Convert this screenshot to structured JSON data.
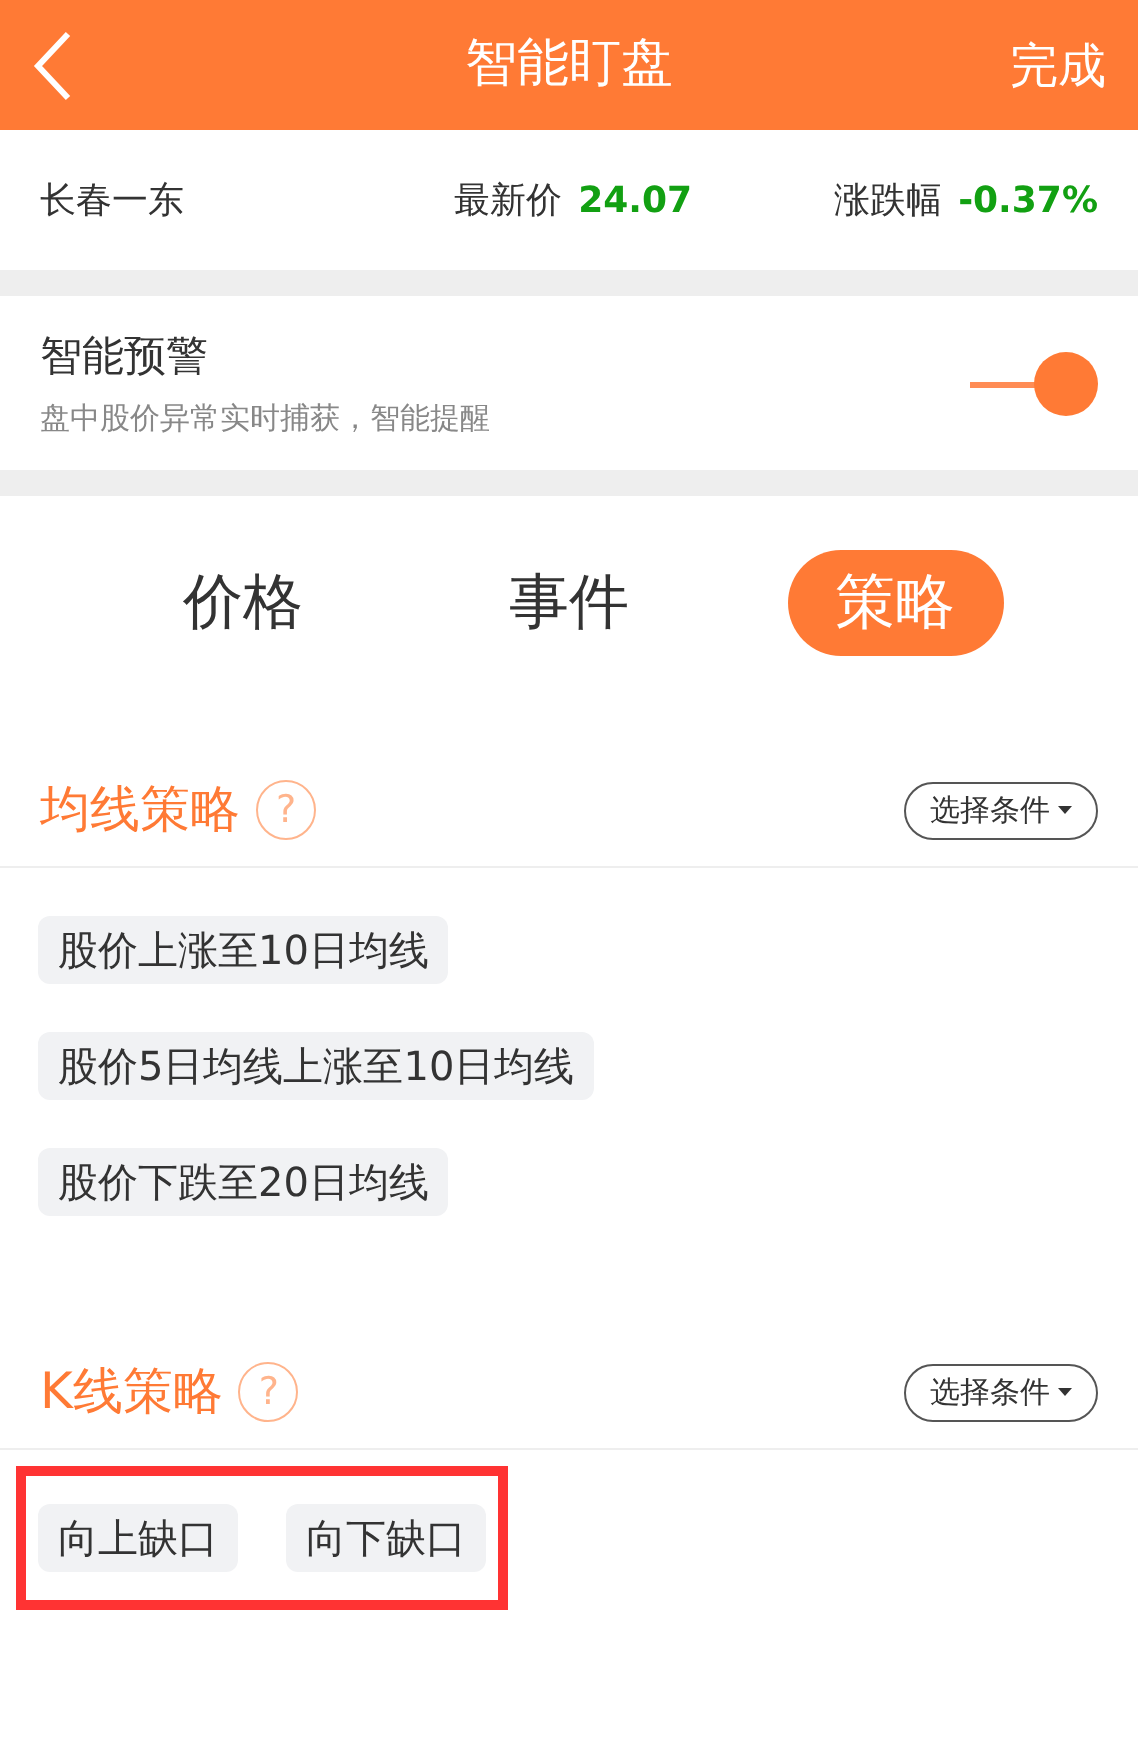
{
  "header": {
    "title": "智能盯盘",
    "action": "完成"
  },
  "quote": {
    "name": "长春一东",
    "price_label": "最新价",
    "price": "24.07",
    "change_label": "涨跌幅",
    "change": "-0.37%"
  },
  "alert": {
    "title": "智能预警",
    "subtitle": "盘中股价异常实时捕获，智能提醒",
    "on": true
  },
  "tabs": [
    {
      "label": "价格",
      "selected": false
    },
    {
      "label": "事件",
      "selected": false
    },
    {
      "label": "策略",
      "selected": true
    }
  ],
  "sections": [
    {
      "title": "均线策略",
      "help": "?",
      "filter": "选择条件",
      "highlighted": false,
      "chips": [
        "股价上涨至10日均线",
        "股价5日均线上涨至10日均线",
        "股价下跌至20日均线"
      ]
    },
    {
      "title": "K线策略",
      "help": "?",
      "filter": "选择条件",
      "highlighted": true,
      "chips": [
        "向上缺口",
        "向下缺口"
      ]
    }
  ]
}
